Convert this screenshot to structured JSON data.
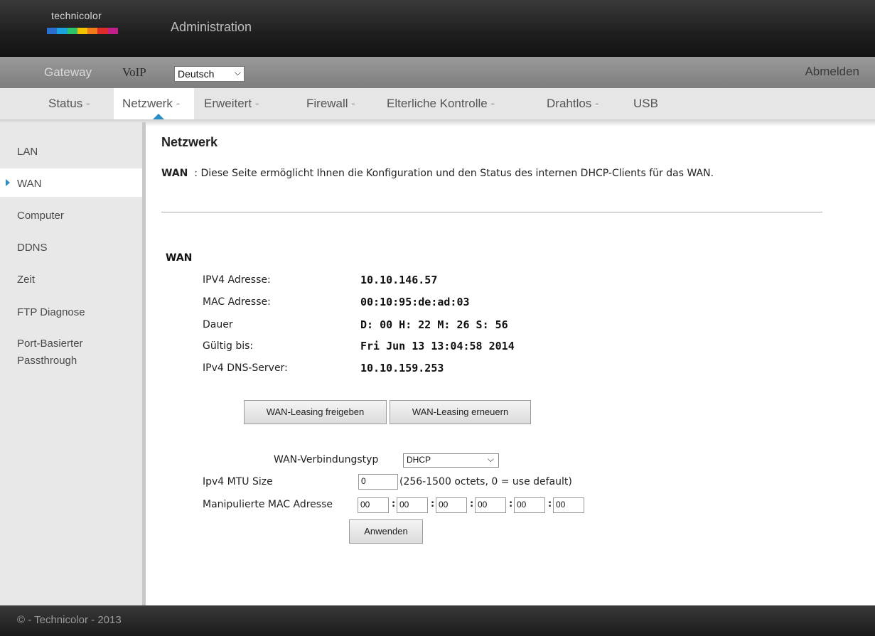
{
  "header": {
    "logo_text": "technicolor",
    "title": "Administration",
    "logo_colors": [
      "#2b6fce",
      "#1aa3e0",
      "#2cc46a",
      "#f2c200",
      "#f27a1a",
      "#e02b2b",
      "#c21f8a"
    ]
  },
  "topnav": {
    "gateway": "Gateway",
    "voip": "VoIP",
    "language": "Deutsch",
    "logout": "Abmelden"
  },
  "subnav": {
    "items": [
      "Status",
      "Netzwerk",
      "Erweitert",
      "Firewall",
      "Elterliche Kontrolle",
      "Drahtlos",
      "USB"
    ],
    "separator": "-",
    "active": "Netzwerk"
  },
  "sidebar": {
    "items": [
      "LAN",
      "WAN",
      "Computer",
      "DDNS",
      "Zeit",
      "FTP Diagnose",
      "Port-Basierter",
      "Passthrough"
    ],
    "active": "WAN"
  },
  "main": {
    "title": "Netzwerk",
    "desc_label": "WAN",
    "desc_text": ": Diese Seite ermöglicht Ihnen die Konfiguration und den Status des internen DHCP-Clients für das WAN.",
    "section": "WAN",
    "rows": [
      {
        "label": "IPV4 Adresse:",
        "value": "10.10.146.57"
      },
      {
        "label": "MAC Adresse:",
        "value": "00:10:95:de:ad:03"
      },
      {
        "label": "Dauer",
        "value": "D: 00 H: 22 M: 26 S: 56"
      },
      {
        "label": "Gültig bis:",
        "value": "Fri Jun 13 13:04:58 2014"
      },
      {
        "label": "IPv4 DNS-Server:",
        "value": "10.10.159.253"
      }
    ],
    "release_button": "WAN-Leasing freigeben",
    "renew_button": "WAN-Leasing erneuern",
    "conn_type_label": "WAN-Verbindungstyp",
    "conn_type_value": "DHCP",
    "mtu_label": "Ipv4 MTU Size",
    "mtu_value": "0",
    "mtu_hint": "(256-1500 octets, 0 = use default)",
    "mac_label": "Manipulierte MAC Adresse",
    "mac_values": [
      "00",
      "00",
      "00",
      "00",
      "00",
      "00"
    ],
    "apply_button": "Anwenden"
  },
  "footer": {
    "text": "© - Technicolor - 2013"
  }
}
